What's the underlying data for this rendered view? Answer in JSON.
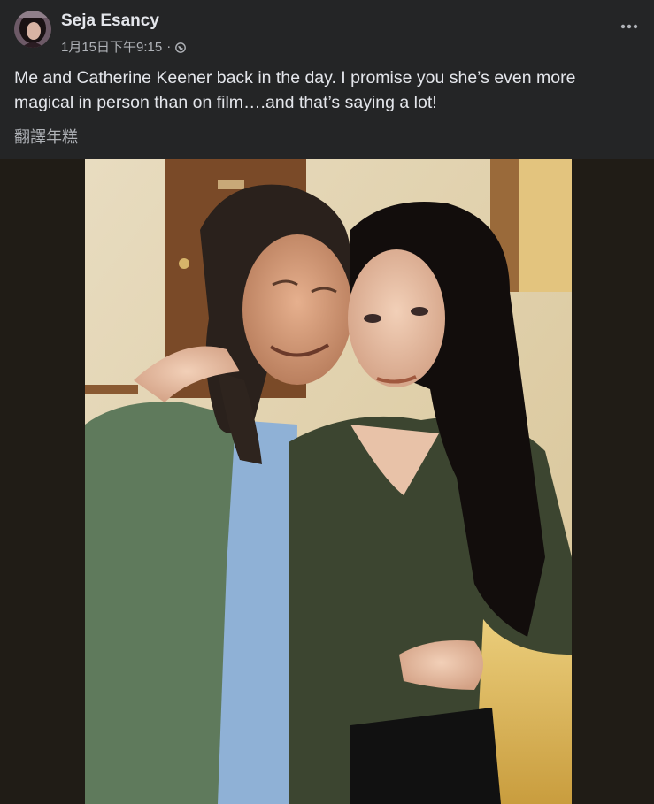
{
  "post": {
    "author_name": "Seja Esancy",
    "timestamp": "1月15日下午9:15",
    "separator": "·",
    "privacy_icon": "globe-icon",
    "more_icon": "more-horizontal-icon",
    "text": "Me and Catherine Keener back in the day. I promise you she’s even more magical in person than on film….and that’s saying a lot!",
    "translate_label": "翻譯年糕"
  },
  "colors": {
    "background": "#242526",
    "text_primary": "#e4e6eb",
    "text_secondary": "#b0b3b8",
    "photo_backdrop": "#201c16"
  }
}
